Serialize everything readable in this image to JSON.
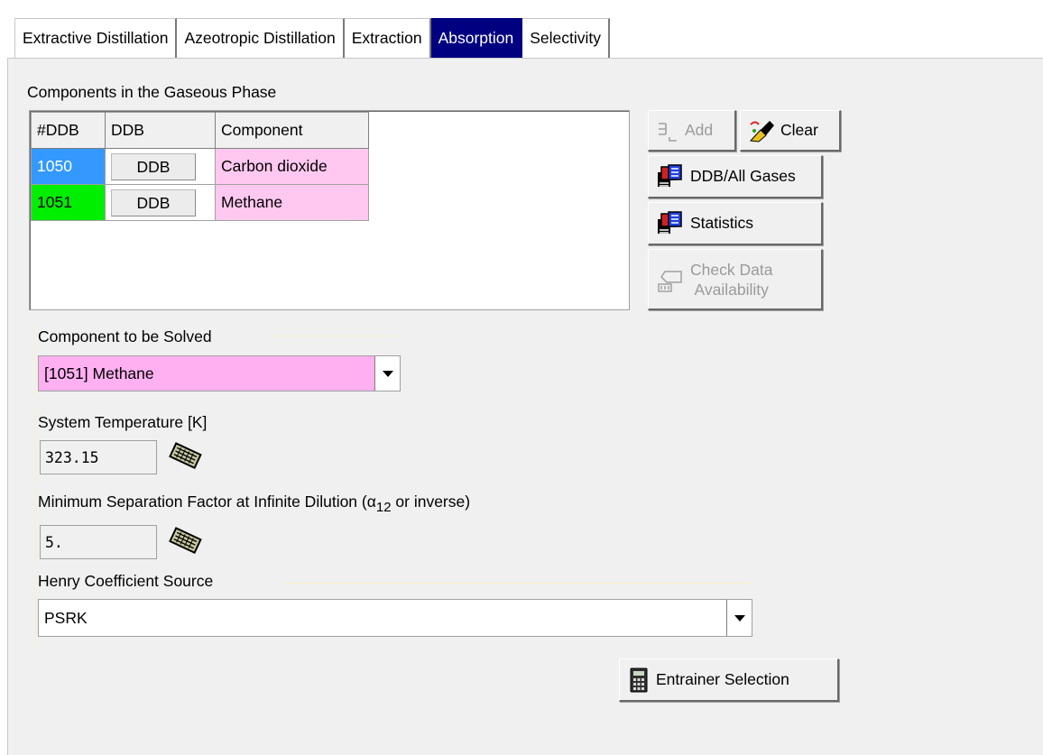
{
  "tabs": [
    {
      "label": "Extractive Distillation",
      "active": false
    },
    {
      "label": "Azeotropic Distillation",
      "active": false
    },
    {
      "label": "Extraction",
      "active": false
    },
    {
      "label": "Absorption",
      "active": true
    },
    {
      "label": "Selectivity",
      "active": false
    }
  ],
  "gaseous": {
    "label": "Components in the Gaseous Phase",
    "columns": [
      "#DDB",
      "DDB",
      "Component"
    ],
    "rows": [
      {
        "no": "1050",
        "ddb": "DDB",
        "component": "Carbon dioxide",
        "no_color": "#3399ff",
        "comp_color": "#ffc8f0"
      },
      {
        "no": "1051",
        "ddb": "DDB",
        "component": "Methane",
        "no_color": "#00ee00",
        "comp_color": "#ffc8f0"
      }
    ]
  },
  "buttons": {
    "add": "Add",
    "clear": "Clear",
    "ddb_all_gases": "DDB/All Gases",
    "statistics": "Statistics",
    "check_line1": "Check Data",
    "check_line2": "Availability",
    "entrainer_selection": "Entrainer Selection"
  },
  "solved": {
    "label": "Component to be Solved",
    "value": "[1051] Methane",
    "value_color": "#ffb0f0"
  },
  "temperature": {
    "label": "System Temperature [K]",
    "value": "323.15"
  },
  "separation": {
    "label_start": "Minimum Separation Factor at Infinite Dilution (α",
    "label_sub": "12",
    "label_end": " or inverse)",
    "value": "5."
  },
  "henry": {
    "label": "Henry Coefficient Source",
    "value": "PSRK"
  },
  "icons": [
    "add-icon",
    "eraser-icon",
    "database-icon",
    "database-icon",
    "check-icon",
    "keyboard-icon",
    "calculator-icon",
    "dropdown-arrow-icon"
  ]
}
